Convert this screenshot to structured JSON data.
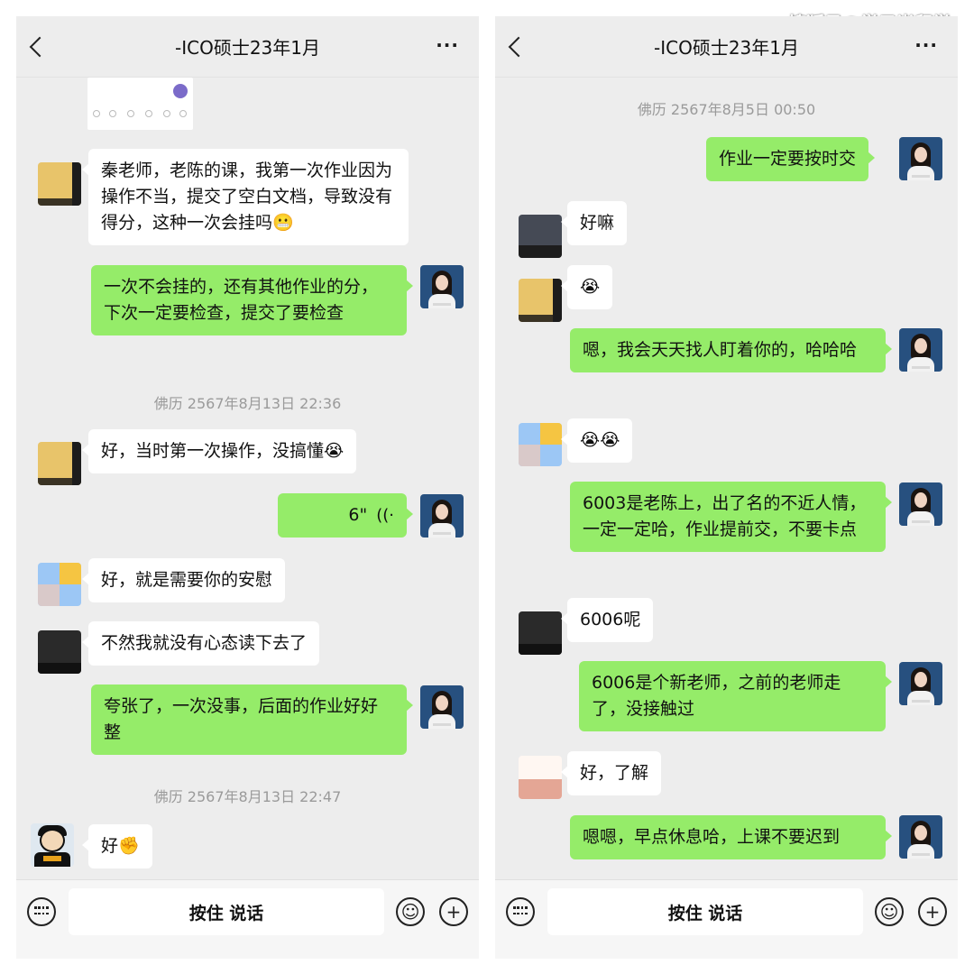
{
  "watermark": "搜狐号@学子尚留学",
  "left": {
    "title": "-ICO硕士23年1月",
    "messages": [
      {
        "text": "秦老师，老陈的课，我第一次作业因为操作不当，提交了空白文档，导致没有得分，这种一次会挂吗"
      },
      {
        "text": "一次不会挂的，还有其他作业的分，下次一定要检查，提交了要检查"
      },
      {
        "time": "佛历 2567年8月13日 22:36"
      },
      {
        "text": "好，当时第一次操作，没搞懂"
      },
      {
        "voice": "6\""
      },
      {
        "text": "好，就是需要你的安慰"
      },
      {
        "text": "不然我就没有心态读下去了"
      },
      {
        "text": "夸张了，一次没事，后面的作业好好整"
      },
      {
        "time": "佛历 2567年8月13日 22:47"
      },
      {
        "text": "好"
      }
    ],
    "input": {
      "hold_label": "按住 说话"
    }
  },
  "right": {
    "title": "-ICO硕士23年1月",
    "messages": [
      {
        "time": "佛历 2567年8月5日 00:50"
      },
      {
        "text": "作业一定要按时交"
      },
      {
        "text": "好嘛"
      },
      {
        "text": "😭"
      },
      {
        "text": "嗯，我会天天找人盯着你的，哈哈哈"
      },
      {
        "text": "😭😭"
      },
      {
        "text": "6003是老陈上，出了名的不近人情，一定一定哈，作业提前交，不要卡点"
      },
      {
        "text": "6006呢"
      },
      {
        "text": "6006是个新老师，之前的老师走了，没接触过"
      },
      {
        "text": "好，了解"
      },
      {
        "text": "嗯嗯，早点休息哈，上课不要迟到"
      }
    ],
    "input": {
      "hold_label": "按住 说话"
    }
  },
  "emoji": {
    "grimace": "😬",
    "laugh_cry": "😭",
    "fist": "✊"
  },
  "icons": {
    "back": "chevron-left-icon",
    "more": "more-dots-icon",
    "voice": "keyboard-voice-icon",
    "emoji": "smiley-icon",
    "plus": "plus-icon"
  },
  "colors": {
    "outgoing_bubble": "#95ec69",
    "incoming_bubble": "#ffffff",
    "background": "#ededed",
    "timestamp": "#9a9a9a"
  }
}
